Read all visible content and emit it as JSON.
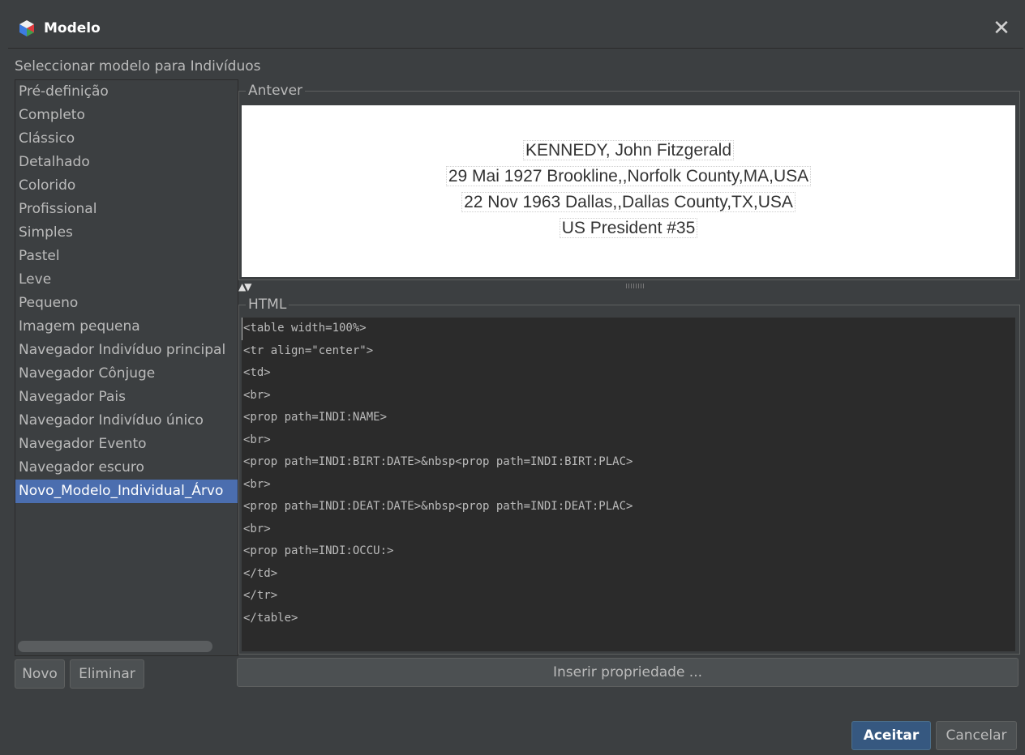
{
  "window": {
    "title": "Modelo"
  },
  "heading": "Seleccionar modelo para Indivíduos",
  "templates": [
    "Pré-definição",
    "Completo",
    "Clássico",
    "Detalhado",
    "Colorido",
    "Profissional",
    "Simples",
    "Pastel",
    "Leve",
    "Pequeno",
    "Imagem pequena",
    "Navegador Indivíduo principal",
    "Navegador Cônjuge",
    "Navegador Pais",
    "Navegador Indivíduo único",
    "Navegador Evento",
    "Navegador escuro",
    "Novo_Modelo_Individual_Árvo"
  ],
  "selected_template": "Novo_Modelo_Individual_Árvo",
  "buttons": {
    "new": "Novo",
    "delete": "Eliminar",
    "insert_property": "Inserir propriedade ...",
    "accept": "Aceitar",
    "cancel": "Cancelar"
  },
  "preview": {
    "label": "Antever",
    "lines": [
      "KENNEDY, John Fitzgerald",
      "29 Mai 1927 Brookline,,Norfolk County,MA,USA",
      "22 Nov 1963 Dallas,,Dallas County,TX,USA",
      "US President #35"
    ]
  },
  "html_editor": {
    "label": "HTML",
    "lines": [
      "<table width=100%>",
      "<tr align=\"center\">",
      "<td>",
      "<br>",
      "<prop path=INDI:NAME>",
      "<br>",
      "<prop path=INDI:BIRT:DATE>&nbsp<prop path=INDI:BIRT:PLAC>",
      "<br>",
      "<prop path=INDI:DEAT:DATE>&nbsp<prop path=INDI:DEAT:PLAC>",
      "<br>",
      "<prop path=INDI:OCCU:>",
      "</td>",
      "</tr>",
      "</table>"
    ]
  },
  "colors": {
    "background": "#3c3f41",
    "selection": "#4b6eaf",
    "primary_button": "#365880",
    "editor_background": "#2b2b2b"
  }
}
